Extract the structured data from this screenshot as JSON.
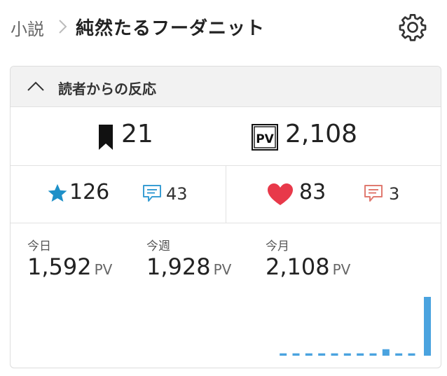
{
  "header": {
    "breadcrumb": "小説",
    "title": "純然たるフーダニット"
  },
  "card": {
    "title": "読者からの反応",
    "bookmarks": "21",
    "pv_total": "2,108",
    "stars": "126",
    "reviews": "43",
    "hearts": "83",
    "comments": "3"
  },
  "stats": [
    {
      "label": "今日",
      "value": "1,592",
      "unit": "PV"
    },
    {
      "label": "今週",
      "value": "1,928",
      "unit": "PV"
    },
    {
      "label": "今月",
      "value": "2,108",
      "unit": "PV"
    }
  ],
  "colors": {
    "accent_blue": "#1e90c8",
    "heart_red": "#e8394a",
    "review_blue": "#3a9ed4",
    "comment_red": "#e07a70",
    "chart_blue": "#4aa3df"
  },
  "chart_data": {
    "type": "bar",
    "values": [
      0.04,
      0.04,
      0.04,
      0.04,
      0.04,
      0.04,
      0.04,
      0.04,
      0.11,
      0.04,
      0.04,
      1.0
    ]
  }
}
